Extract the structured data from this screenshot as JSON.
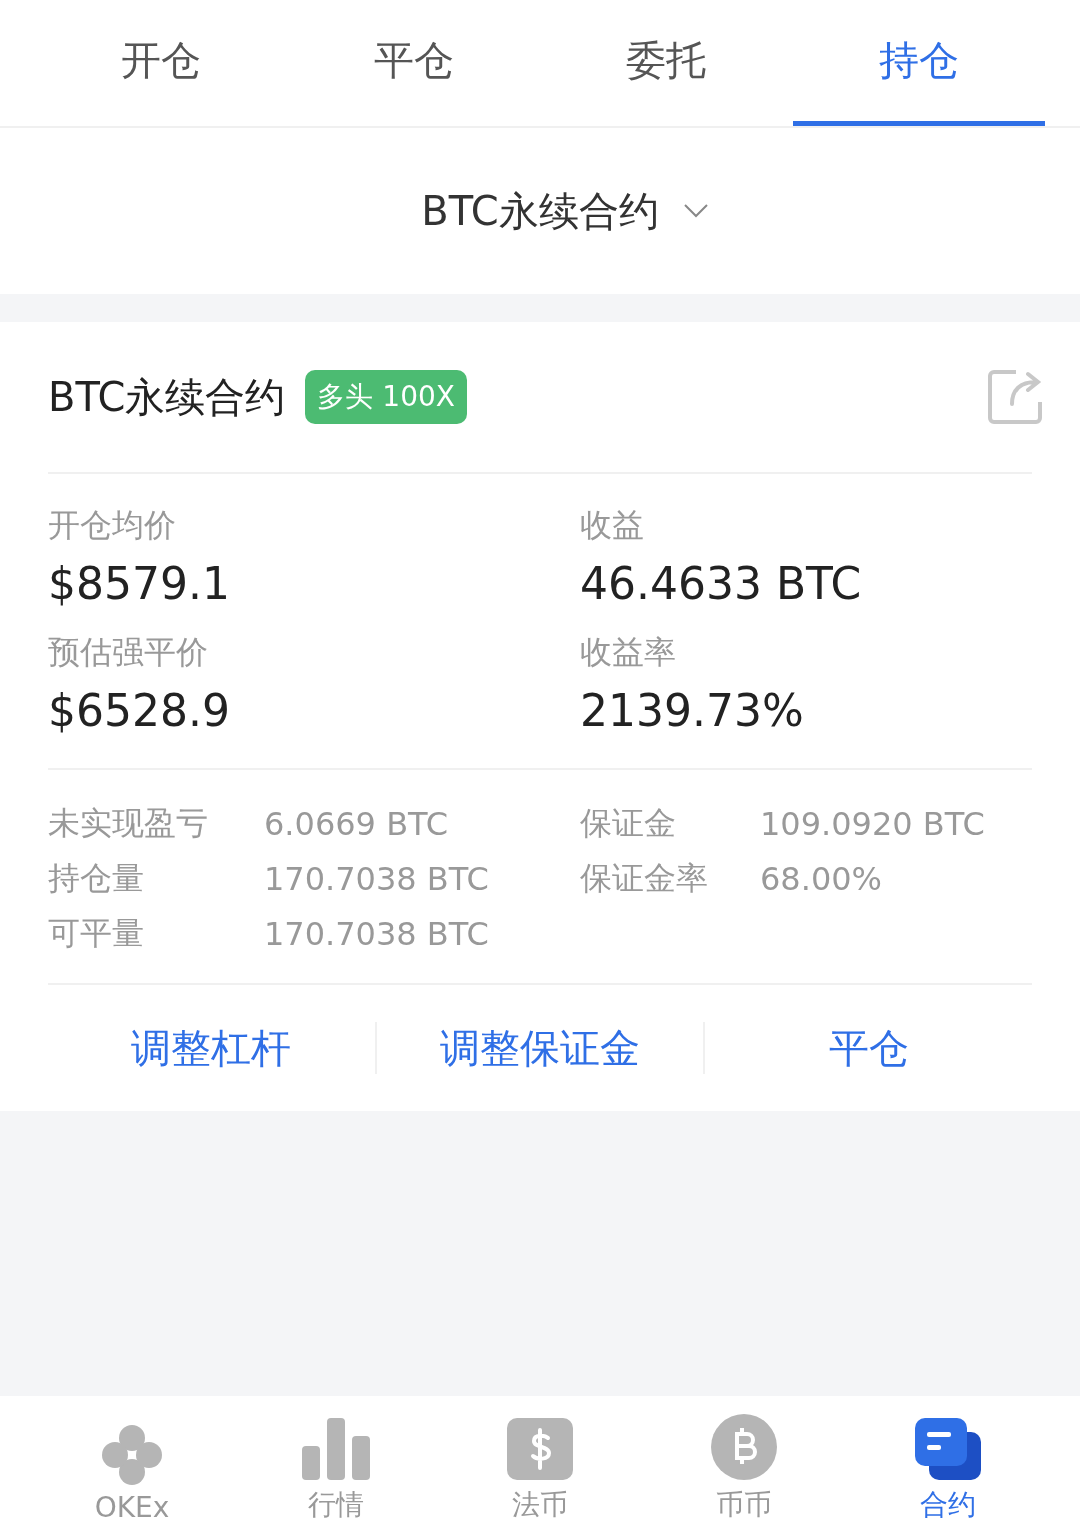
{
  "tabs": [
    {
      "label": "开仓",
      "selected": false
    },
    {
      "label": "平仓",
      "selected": false
    },
    {
      "label": "委托",
      "selected": false
    },
    {
      "label": "持仓",
      "selected": true
    }
  ],
  "contract_selector": {
    "label": "BTC永续合约"
  },
  "position": {
    "title": "BTC永续合约",
    "badge": "多头 100X",
    "metrics": [
      {
        "label": "开仓均价",
        "value": "$8579.1"
      },
      {
        "label": "收益",
        "value": "46.4633 BTC"
      },
      {
        "label": "预估强平价",
        "value": "$6528.9"
      },
      {
        "label": "收益率",
        "value": "2139.73%"
      }
    ],
    "details_left": [
      {
        "label": "未实现盈亏",
        "value": "6.0669 BTC"
      },
      {
        "label": "持仓量",
        "value": "170.7038 BTC"
      },
      {
        "label": "可平量",
        "value": "170.7038 BTC"
      }
    ],
    "details_right": [
      {
        "label": "保证金",
        "value": "109.0920 BTC"
      },
      {
        "label": "保证金率",
        "value": "68.00%"
      }
    ],
    "actions": [
      "调整杠杆",
      "调整保证金",
      "平仓"
    ]
  },
  "bottom_nav": [
    {
      "label": "OKEx",
      "kind": "logo",
      "selected": false
    },
    {
      "label": "行情",
      "kind": "bars",
      "selected": false
    },
    {
      "label": "法币",
      "kind": "dollar",
      "selected": false
    },
    {
      "label": "币币",
      "kind": "bitcoin",
      "selected": false
    },
    {
      "label": "合约",
      "kind": "contract",
      "selected": true
    }
  ]
}
